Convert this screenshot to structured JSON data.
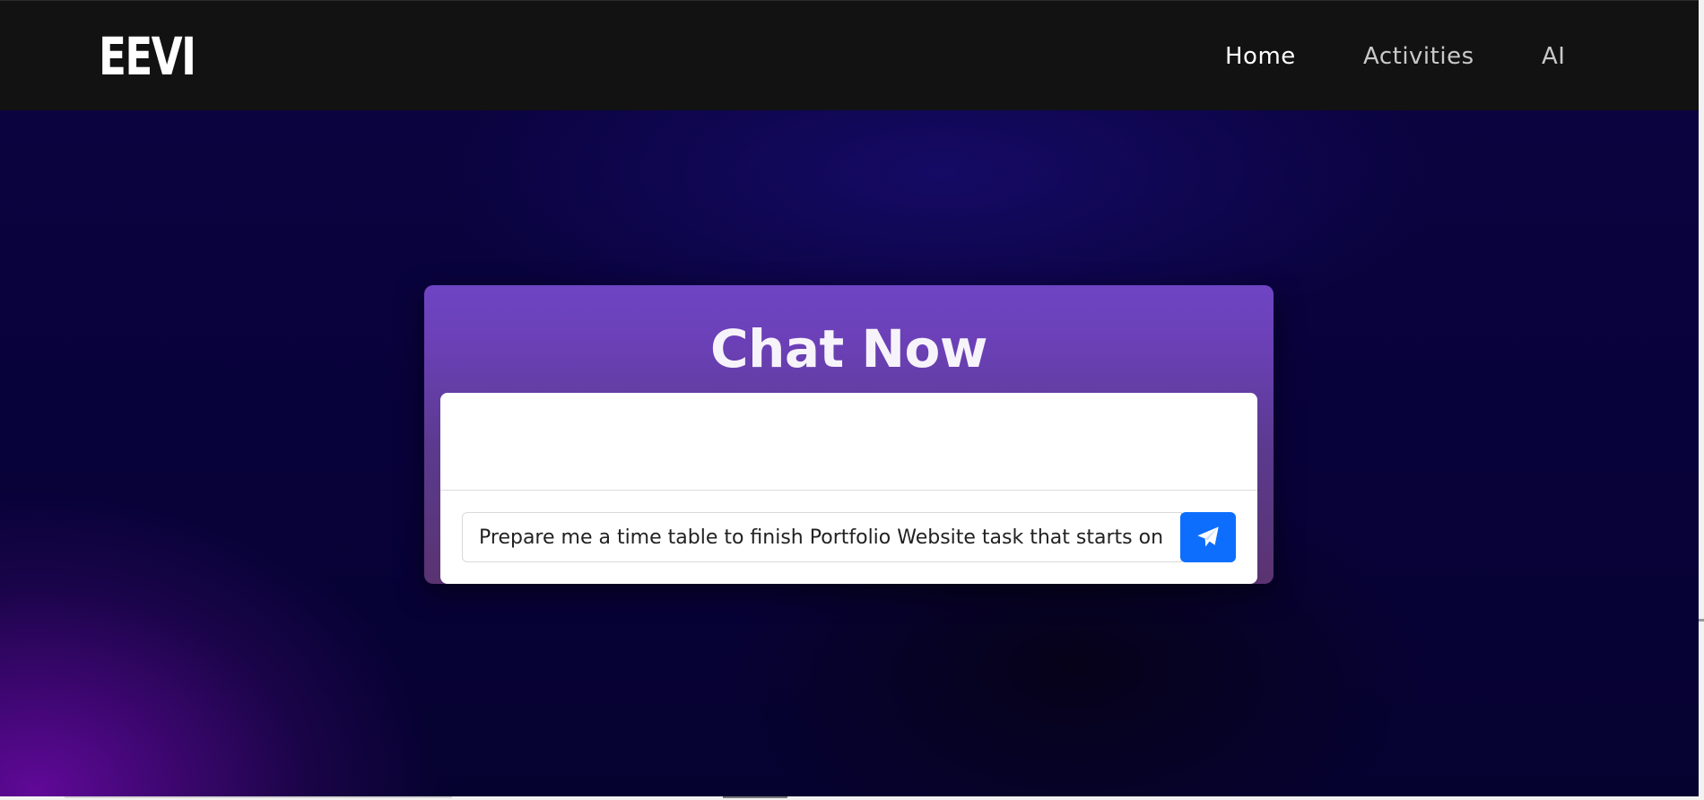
{
  "header": {
    "logo": "EEVI",
    "nav": [
      {
        "label": "Home",
        "active": true
      },
      {
        "label": "Activities",
        "active": false
      },
      {
        "label": "AI",
        "active": false
      }
    ]
  },
  "chat": {
    "title": "Chat Now",
    "input_value": "Prepare me a time table to finish Portfolio Website task that starts on",
    "send_icon": "paper-plane-icon"
  },
  "colors": {
    "navbar": "#121212",
    "card_top": "#6f44c4",
    "send_button": "#0d6efd",
    "background": "#08023a"
  }
}
